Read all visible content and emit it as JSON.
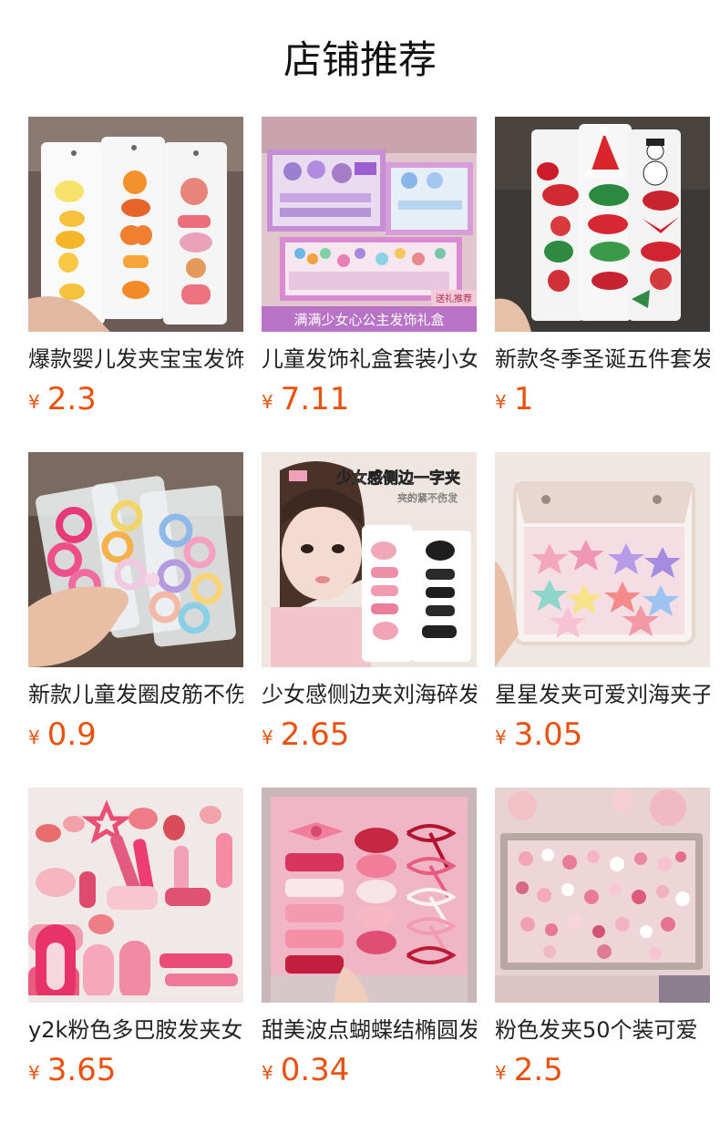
{
  "section_title": "店铺推荐",
  "currency_symbol": "¥",
  "colors": {
    "price": "#e8510e",
    "title": "#111111",
    "name": "#222222"
  },
  "products": [
    {
      "name": "爆款婴儿发夹宝宝发饰",
      "price": "2.3",
      "image": "baby-hair-clips-card",
      "overlay": ""
    },
    {
      "name": "儿童发饰礼盒套装小女孩",
      "price": "7.11",
      "image": "kids-hair-accessory-gift-box",
      "overlay": "满满少女心公主发饰礼盒",
      "tag": "送礼推荐"
    },
    {
      "name": "新款冬季圣诞五件套发夹",
      "price": "1",
      "image": "christmas-hair-clips-card",
      "overlay": ""
    },
    {
      "name": "新款儿童发圈皮筋不伤发",
      "price": "0.9",
      "image": "kids-hair-ties-bags",
      "overlay": ""
    },
    {
      "name": "少女感侧边夹刘海碎发夹",
      "price": "2.65",
      "image": "girl-side-clips",
      "overlay": "少女感侧边一字夹",
      "overlay2": "夹的紧不伤发"
    },
    {
      "name": "星星发夹可爱刘海夹子",
      "price": "3.05",
      "image": "star-hair-clips-bag",
      "overlay": ""
    },
    {
      "name": "y2k粉色多巴胺发夹女",
      "price": "3.65",
      "image": "pink-y2k-hair-clips",
      "overlay": ""
    },
    {
      "name": "甜美波点蝴蝶结椭圆发夹",
      "price": "0.34",
      "image": "polka-dot-bow-clips",
      "overlay": ""
    },
    {
      "name": "粉色发夹50个装可爱",
      "price": "2.5",
      "image": "pink-clips-50-box",
      "overlay": ""
    }
  ]
}
